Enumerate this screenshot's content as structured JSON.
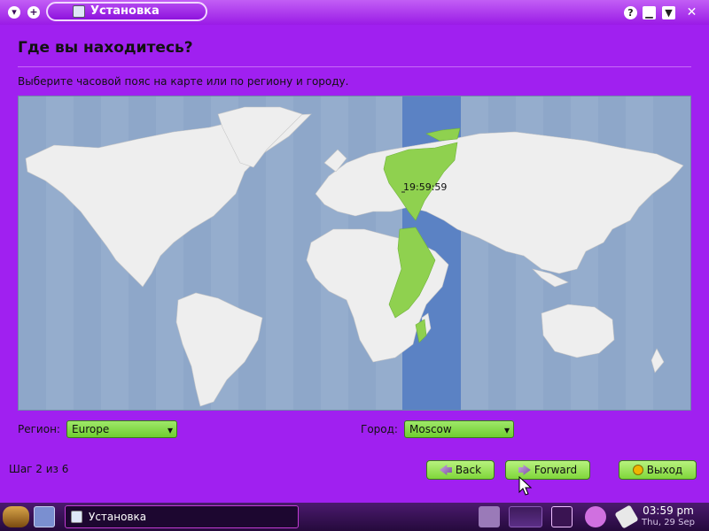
{
  "window": {
    "title": "Установка",
    "help_label": "?"
  },
  "page": {
    "heading": "Где вы находитесь?",
    "instruction": "Выберите часовой пояс на карте или по региону и городу."
  },
  "map": {
    "clock": "19:59:59"
  },
  "region": {
    "label": "Регион:",
    "value": "Europe"
  },
  "city": {
    "label": "Город:",
    "value": "Moscow"
  },
  "footer": {
    "step": "Шаг 2 из 6",
    "back": "Back",
    "forward": "Forward",
    "quit": "Выход"
  },
  "taskbar": {
    "task_label": "Установка",
    "time": "03:59 pm",
    "date": "Thu, 29 Sep"
  },
  "colors": {
    "window_bg": "#a020f0",
    "accent_green": "#8fd14f",
    "map_water": "#8ea7c9",
    "selected_zone": "#5b82c4"
  }
}
